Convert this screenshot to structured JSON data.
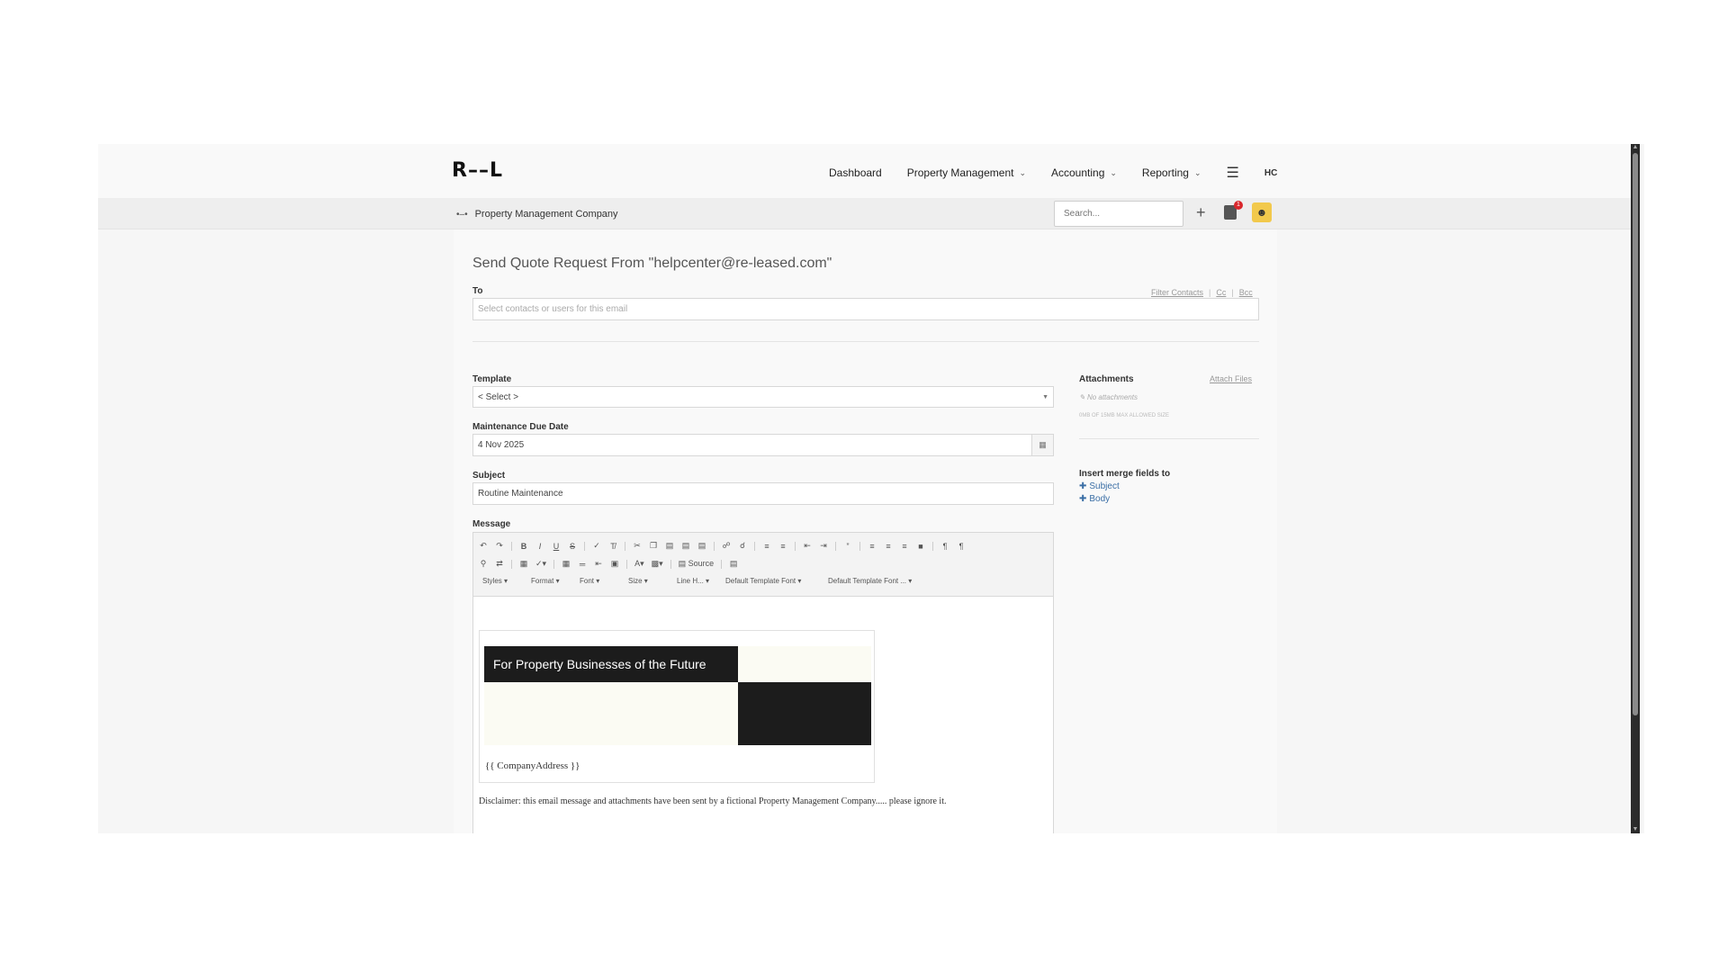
{
  "brand": {
    "logo": "R––L"
  },
  "nav": {
    "dashboard": "Dashboard",
    "property_management": "Property Management",
    "accounting": "Accounting",
    "reporting": "Reporting",
    "user_initials": "HC"
  },
  "subbar": {
    "company": "Property Management Company",
    "search_placeholder": "Search...",
    "notification_count": "1"
  },
  "form": {
    "title": "Send Quote Request From \"helpcenter@re-leased.com\"",
    "to_label": "To",
    "to_placeholder": "Select contacts or users for this email",
    "filter_contacts": "Filter Contacts",
    "cc": "Cc",
    "bcc": "Bcc",
    "template_label": "Template",
    "template_value": "< Select >",
    "due_date_label": "Maintenance Due Date",
    "due_date_value": "4 Nov 2025",
    "subject_label": "Subject",
    "subject_value": "Routine Maintenance",
    "message_label": "Message"
  },
  "attachments": {
    "label": "Attachments",
    "attach_files": "Attach Files",
    "none": "No attachments",
    "size_info": "0MB OF 15MB MAX ALLOWED SIZE"
  },
  "merge": {
    "label": "Insert merge fields to",
    "subject": "Subject",
    "body": "Body"
  },
  "editor": {
    "toolbar_dropdowns": [
      "Styles",
      "Format",
      "Font",
      "Size",
      "Line H...",
      "Default Template Font",
      "Default Template Font ..."
    ],
    "source_label": "Source",
    "banner_text": "For Property Businesses of the Future",
    "address": "{{ CompanyAddress }}",
    "disclaimer": "Disclaimer:  this email message and attachments have been sent by a fictional Property Management Company..... please ignore it."
  },
  "colors": {
    "accent_link": "#3a6ea5",
    "badge": "#d9262b",
    "avatar": "#f2c94c"
  }
}
